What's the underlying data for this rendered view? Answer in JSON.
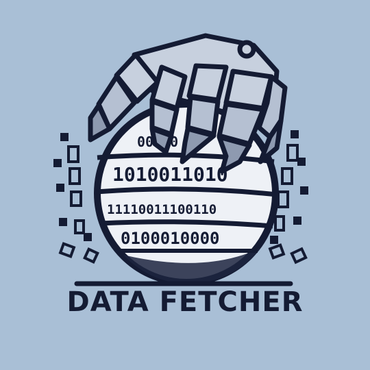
{
  "brand": {
    "title": "DATA FETCHER",
    "colors": {
      "background": "#a9bfd6",
      "ink": "#141b33",
      "metal": "#c7d0de",
      "metal_shadow": "#8e9ab0",
      "sphere": "#eef1f6"
    }
  },
  "globe": {
    "binary_rows": [
      "00100",
      "1010011010",
      "11110011100110",
      "0100010000"
    ]
  },
  "icons": [
    "robotic-claw-icon",
    "binary-globe-icon",
    "data-bits-icon"
  ]
}
